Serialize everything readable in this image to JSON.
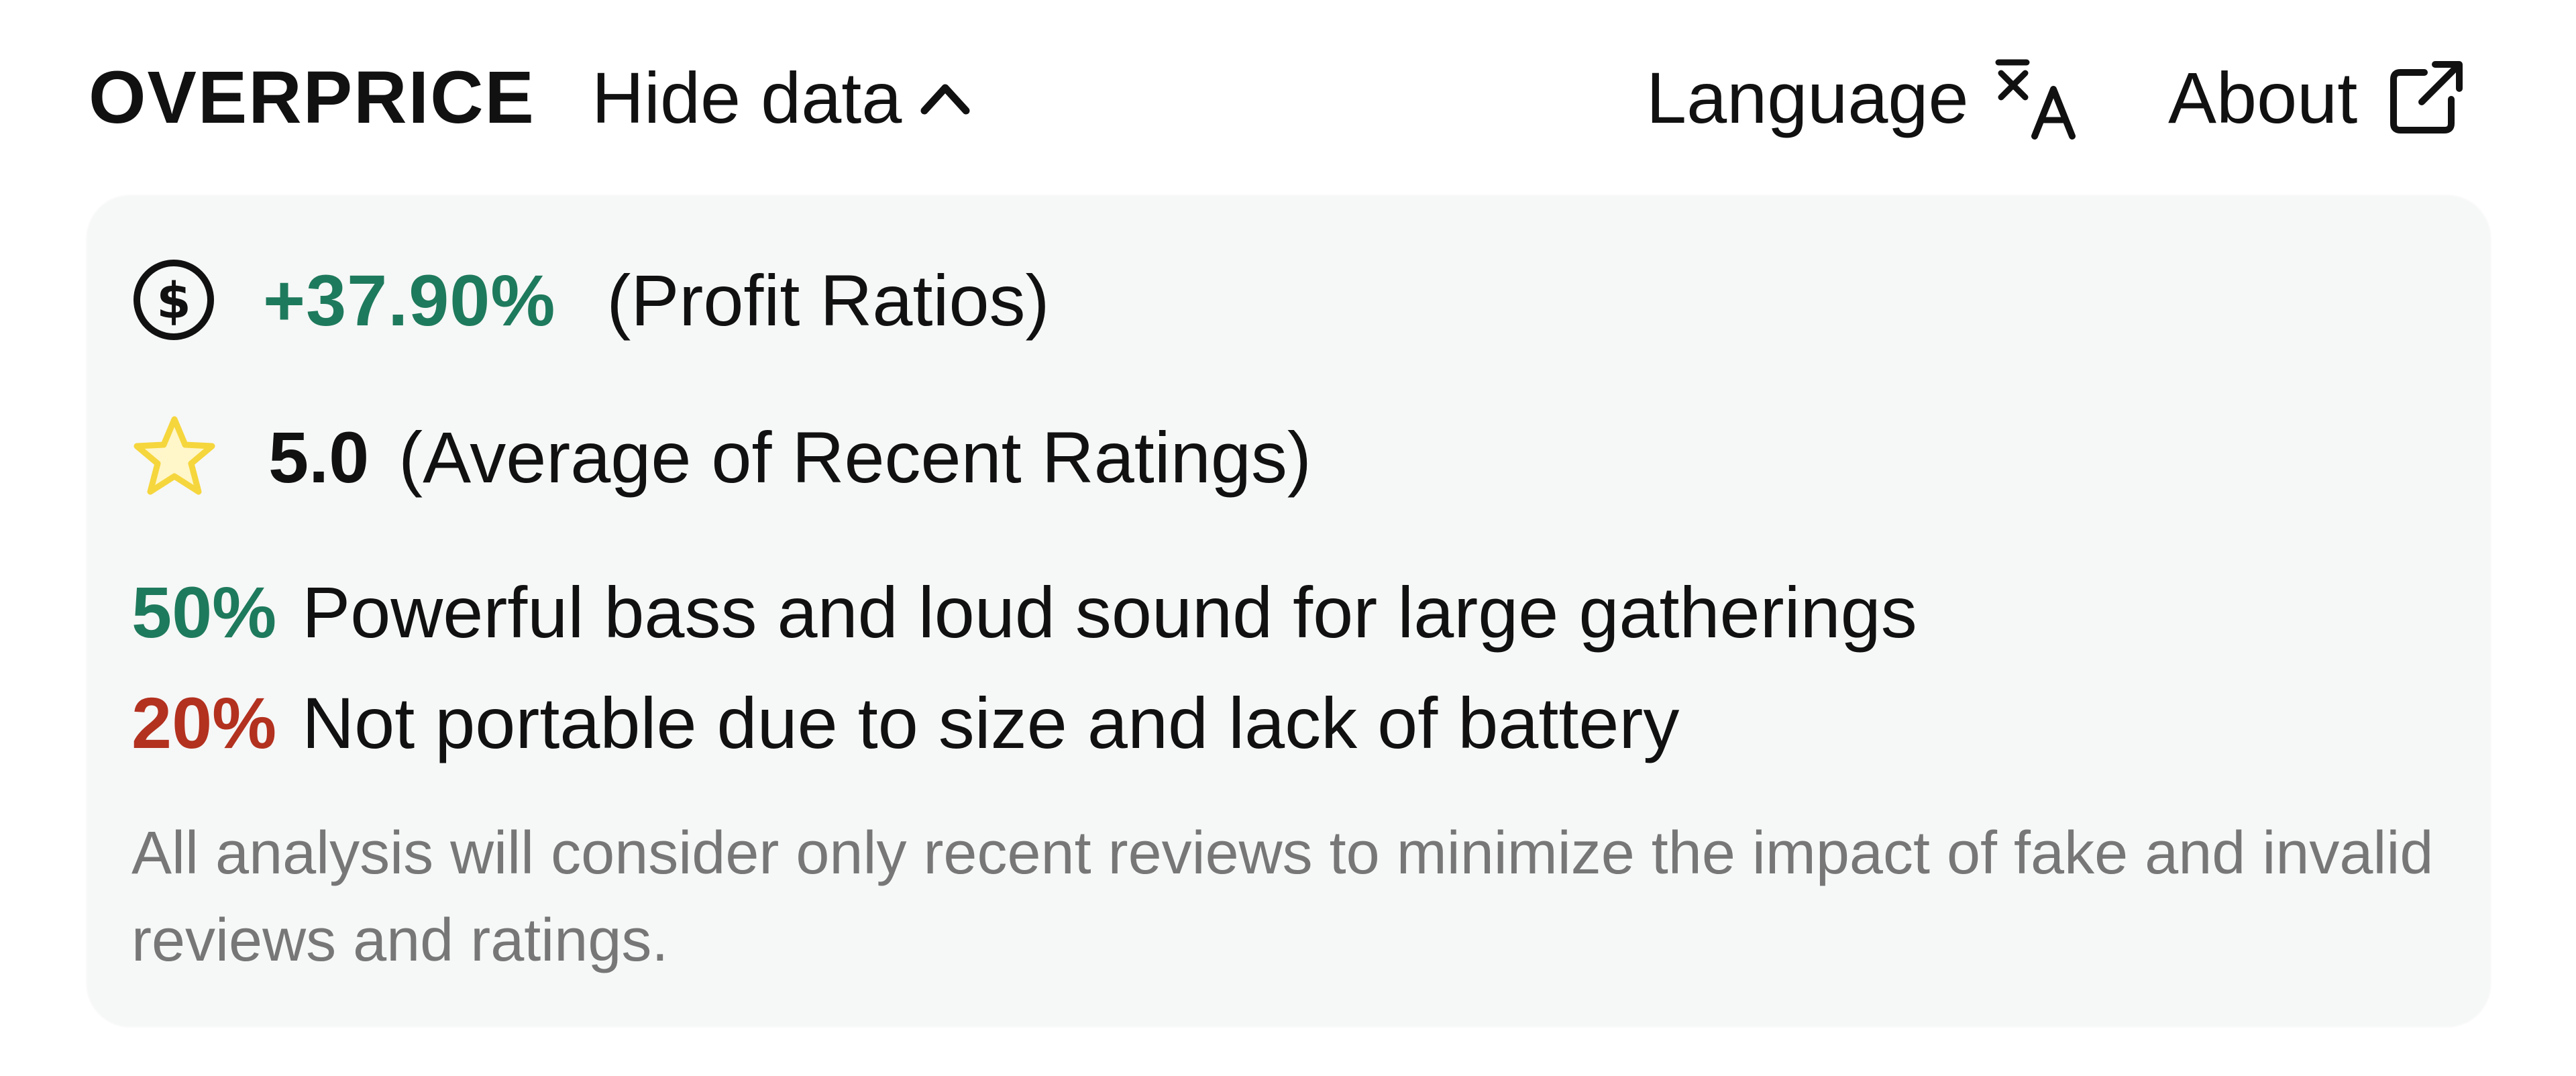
{
  "header": {
    "brand": "OVERPRICE",
    "toggle_label": "Hide data",
    "toggle_icon": "chevron-up-icon",
    "language_label": "Language",
    "language_icon": "translate-icon",
    "about_label": "About",
    "about_icon": "external-link-icon"
  },
  "summary": {
    "profit": {
      "icon": "dollar-circle-icon",
      "value": "+37.90%",
      "label": "(Profit Ratios)"
    },
    "rating": {
      "icon": "star-icon",
      "value": "5.0",
      "label": "(Average of Recent Ratings)"
    },
    "insights": [
      {
        "percent": "50%",
        "text": "Powerful bass and loud sound for large gatherings",
        "sentiment": "positive"
      },
      {
        "percent": "20%",
        "text": "Not portable due to size and lack of battery",
        "sentiment": "negative"
      }
    ],
    "note": "All analysis will consider only recent reviews to minimize the impact of fake and invalid reviews and ratings."
  },
  "colors": {
    "positive": "#1e7a5c",
    "negative": "#b3311f",
    "star": "#f5d63d",
    "card_bg": "#f6f7f7",
    "note_text": "#777777"
  }
}
